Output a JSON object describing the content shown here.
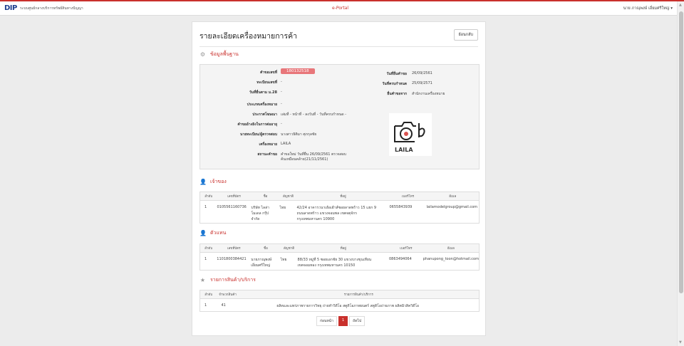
{
  "header": {
    "logo": "DIP",
    "org": "ระบบศูนย์กลางบริการทรัพย์สินทางปัญญา",
    "portal": "e-Portal",
    "user": "นาย ภาณุพงษ์ เอี่ยมศรีใหญ่"
  },
  "page": {
    "title": "รายละเอียดเครื่องหมายการค้า",
    "back": "ย้อนกลับ"
  },
  "basic": {
    "section": "ข้อมูลพื้นฐาน",
    "labels": {
      "req_no": "คำขอเลขที่",
      "reg_no": "ทะเบียนเลขที่",
      "date_28": "วันที่ยื่นตาม ม.28",
      "mark_type": "ประเภทเครื่องหมาย",
      "announce": "ประกาศโฆษณา",
      "related": "คำขออ้างอิงในการต่ออายุ",
      "agent": "นายทะเบียน/ผู้ตรวจสอบ",
      "mark": "เครื่องหมาย",
      "status": "สถานะคำขอ",
      "filed": "วันที่ยื่นคำขอ",
      "expire": "วันที่ครบกำหนด",
      "office": "ยื่นคำขอจาก"
    },
    "values": {
      "req_no": "180132518",
      "reg_no": "-",
      "date_28": "-",
      "mark_type": "-",
      "announce": "เล่มที่ - หน้าที่ - ลงวันที่ - วันที่ครบกำหนด -",
      "related": "-",
      "agent": "นางสาวธิติมา ศุภกุลชัย",
      "mark": "LAILA",
      "status1": "คำขอใหม่ วันที่ยื่น 26/09/2561 ตรวจสอบ",
      "status2": "ค้นเหมือนคล้าย(21/11/2561)",
      "filed": "26/09/2561",
      "expire": "25/09/2571",
      "office": "สำนักงานเครื่องหมาย"
    },
    "mark_image_text": "LAILA"
  },
  "owner": {
    "section": "เจ้าของ",
    "headers": [
      "ลำดับ",
      "เลขที่บัตร",
      "ชื่อ",
      "สัญชาติ",
      "ที่อยู่",
      "เบอร์โทร",
      "อีเมล"
    ],
    "row": {
      "no": "1",
      "id": "0105561160736",
      "name1": "บริษัท ไลล่า",
      "name2": "โมเดล กรุ๊ป",
      "name3": "จำกัด",
      "nation": "ไทย",
      "addr1": "42/24 อาคารวนาเฮ้อเฮ้าส์ซอยลาดพร้าว 15 แยก 9",
      "addr2": "ถนนลาดพร้าว แขวงจอมพล เขตจตุจักร",
      "addr3": "กรุงเทพมหานคร 10900",
      "phone": "0655843939",
      "email": "lailamodelgroup@gmail.com"
    }
  },
  "agent_sec": {
    "section": "ตัวแทน",
    "headers": [
      "ลำดับ",
      "เลขที่บัตร",
      "ชื่อ",
      "สัญชาติ",
      "ที่อยู่",
      "เบอร์โทร",
      "อีเมล"
    ],
    "row": {
      "no": "1",
      "id": "1101800384421",
      "name1": "นายภาณุพงษ์",
      "name2": "เอี่ยมศรีใหญ่",
      "nation": "ไทย",
      "addr1": "88/33 หมู่ที่ 5 ซอยเอกชัย 30 แขวงบางขุนเทียน",
      "addr2": "เขตจอมทอง กรุงเทพมหานคร 10150",
      "phone": "0863494064",
      "email": "phanupong_toon@hotmail.com"
    }
  },
  "services": {
    "section": "รายการสินค้า/บริการ",
    "headers": [
      "ลำดับ",
      "จำพวกสินค้า",
      "รายการสินค้า/บริการ"
    ],
    "row": {
      "no": "1",
      "class": "41",
      "item": "ผลิตและแพร่ภาพรายการวิทยุ ถ่ายทำวิดีโอ สตูดิโอภาพยนตร์ สตูดิโอถ่ายภาพ ผลิตมิวสิควิดีโอ"
    }
  },
  "pager": {
    "prev": "ก่อนหน้า",
    "page": "1",
    "next": "ถัดไป"
  },
  "colors": {
    "accent": "#c9302c",
    "badge": "#e8767a"
  }
}
